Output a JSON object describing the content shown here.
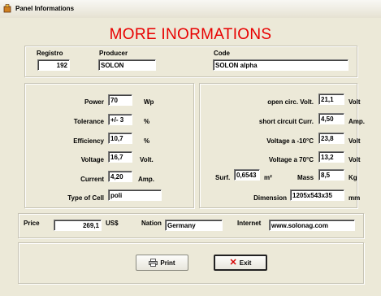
{
  "window": {
    "title": "Panel Informations"
  },
  "heading": "MORE INORMATIONS",
  "top": {
    "registro_label": "Registro",
    "registro_value": "192",
    "producer_label": "Producer",
    "producer_value": "SOLON",
    "code_label": "Code",
    "code_value": "SOLON alpha"
  },
  "left": {
    "power_label": "Power",
    "power_value": "70",
    "power_unit": "Wp",
    "tolerance_label": "Tolerance",
    "tolerance_value": "+/- 3",
    "tolerance_unit": "%",
    "efficiency_label": "Efficiency",
    "efficiency_value": "10,7",
    "efficiency_unit": "%",
    "voltage_label": "Voltage",
    "voltage_value": "16,7",
    "voltage_unit": "Volt.",
    "current_label": "Current",
    "current_value": "4,20",
    "current_unit": "Amp.",
    "cell_label": "Type of Cell",
    "cell_value": "poli"
  },
  "right": {
    "ocv_label": "open circ. Volt.",
    "ocv_value": "21,1",
    "ocv_unit": "Volt",
    "scc_label": "short circuit Curr.",
    "scc_value": "4,50",
    "scc_unit": "Amp.",
    "vm10_label": "Voltage a -10°C",
    "vm10_value": "23,8",
    "vm10_unit": "Volt",
    "v70_label": "Voltage a 70°C",
    "v70_value": "13,2",
    "v70_unit": "Volt",
    "surf_label": "Surf.",
    "surf_value": "0,6543",
    "surf_unit": "m²",
    "mass_label": "Mass",
    "mass_value": "8,5",
    "mass_unit": "Kg",
    "dim_label": "Dimension",
    "dim_value": "1205x543x35",
    "dim_unit": "mm"
  },
  "bottom": {
    "price_label": "Price",
    "price_value": "269,1",
    "price_unit": "US$",
    "nation_label": "Nation",
    "nation_value": "Germany",
    "internet_label": "Internet",
    "internet_value": "www.solonag.com"
  },
  "buttons": {
    "print_label": "Print",
    "exit_label": "Exit"
  },
  "colors": {
    "heading": "#e80000",
    "exit_icon": "#d40000",
    "background": "#ece9d8"
  }
}
